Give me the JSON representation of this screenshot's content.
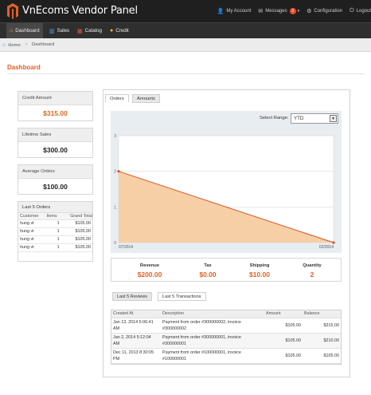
{
  "app": {
    "title": "VnEcoms Vendor Panel",
    "accent": "#e1612b"
  },
  "top_links": {
    "account": "My Account",
    "messages": "Messages",
    "messages_count": "3",
    "configuration": "Configuration",
    "logout": "Logout"
  },
  "nav": [
    {
      "label": "Dashboard",
      "icon": "home-icon"
    },
    {
      "label": "Sales",
      "icon": "bar-chart-icon"
    },
    {
      "label": "Catalog",
      "icon": "grid-icon"
    },
    {
      "label": "Credit",
      "icon": "coin-icon"
    }
  ],
  "breadcrumb": {
    "home": "Home",
    "current": "Dashboard"
  },
  "page_title": "Dashboard",
  "stats": [
    {
      "label": "Credit Amount",
      "value": "$315.00",
      "color": "#d9691c"
    },
    {
      "label": "Lifetime Sales",
      "value": "$300.00",
      "color": "#222222"
    },
    {
      "label": "Average Orders",
      "value": "$100.00",
      "color": "#222222"
    }
  ],
  "last_orders": {
    "title": "Last 5 Orders",
    "headers": [
      "Customer",
      "Items",
      "Grand Total"
    ],
    "rows": [
      [
        "hung vt",
        "1",
        "$105.00"
      ],
      [
        "hung vt",
        "1",
        "$105.00"
      ],
      [
        "hung vt",
        "1",
        "$105.00"
      ],
      [
        "hung vt",
        "1",
        "$105.00"
      ]
    ]
  },
  "chart_tabs": [
    "Orders",
    "Amounts"
  ],
  "range": {
    "label": "Select Range:",
    "value": "YTD"
  },
  "chart_data": {
    "type": "area",
    "x": [
      "07/2014",
      "02/2014"
    ],
    "values": [
      2,
      0
    ],
    "ylim": [
      0,
      3
    ],
    "yticks": [
      "0",
      "1",
      "2",
      "3"
    ],
    "fill": "#f6cfa7",
    "line": "#d9531e",
    "grid": true
  },
  "summary": [
    {
      "label": "Revenue",
      "value": "$200.00"
    },
    {
      "label": "Tax",
      "value": "$0.00"
    },
    {
      "label": "Shipping",
      "value": "$10.00"
    },
    {
      "label": "Quantity",
      "value": "2"
    }
  ],
  "bottom_tabs": [
    "Last 5 Reviews",
    "Last 5 Transactions"
  ],
  "transactions": {
    "headers": [
      "Created At",
      "Description",
      "Amount",
      "Balance"
    ],
    "rows": [
      {
        "created_1": "Jan 13, 2014 5:06:41",
        "created_2": "AM",
        "desc_1": "Payment from order #300000002, invoice",
        "desc_2": "#300000002",
        "amount": "$105.00",
        "balance": "$315.00"
      },
      {
        "created_1": "Jan 2, 2014 5:12:04",
        "created_2": "AM",
        "desc_1": "Payment from order #300000001, invoice",
        "desc_2": "#300000001",
        "amount": "$105.00",
        "balance": "$210.00"
      },
      {
        "created_1": "Dec 11, 2013 8:30:05",
        "created_2": "PM",
        "desc_1": "Payment from order #100000001, invoice",
        "desc_2": "#100000001",
        "amount": "$105.00",
        "balance": "$105.00"
      }
    ]
  }
}
